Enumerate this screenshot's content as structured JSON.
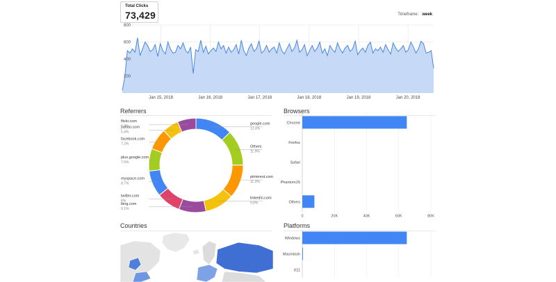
{
  "total_clicks": {
    "label": "Total Clicks",
    "value": "73,429"
  },
  "timeframe": {
    "label": "Timeframe:",
    "value": "week"
  },
  "sections": {
    "referrers": "Referrers",
    "browsers": "Browsers",
    "countries": "Countries",
    "platforms": "Platforms"
  },
  "colors": {
    "accent_blue": "#4285f4",
    "area_fill": "#c6d9f7",
    "line": "#4a86e0"
  },
  "chart_data": [
    {
      "id": "clicks-timeline",
      "type": "area",
      "ylim": [
        0,
        800
      ],
      "y_ticks": [
        "800",
        "600",
        "400",
        "200"
      ],
      "x_tick_labels": [
        "Jan 15, 2018",
        "Jan 16, 2018",
        "Jan 17, 2018",
        "Jan 18, 2018",
        "Jan 19, 2018",
        "Jan 20, 2018"
      ],
      "values": [
        30,
        190,
        500,
        470,
        520,
        480,
        650,
        440,
        520,
        600,
        560,
        490,
        510,
        570,
        430,
        580,
        500,
        460,
        600,
        520,
        470,
        480,
        560,
        520,
        590,
        500,
        470,
        540,
        230,
        510,
        490,
        620,
        480,
        550,
        460,
        500,
        530,
        490,
        600,
        520,
        560,
        470,
        540,
        480,
        510,
        570,
        460,
        620,
        500,
        440,
        530,
        580,
        490,
        520,
        610,
        470,
        500,
        560,
        480,
        520,
        540,
        470,
        590,
        500,
        460,
        520,
        580,
        490,
        530,
        620,
        480,
        510,
        570,
        440,
        500,
        560,
        490,
        530,
        600,
        470,
        520,
        440,
        560,
        510,
        480,
        590,
        520,
        470,
        530,
        560,
        490,
        520,
        610,
        450,
        500,
        530,
        480,
        560,
        600,
        470,
        520,
        500,
        540,
        480,
        570,
        510,
        460,
        590,
        530,
        490,
        520,
        560,
        480,
        510,
        600,
        540,
        470,
        520,
        610,
        580,
        470,
        480,
        500,
        290
      ]
    },
    {
      "id": "referrers-donut",
      "type": "pie",
      "categories": [
        "google.com",
        "Others",
        "pinterest.com",
        "linkedin.com",
        "bing.com",
        "twitter.com",
        "myspace.com",
        "plus.google.com",
        "facebook.com",
        "yahoo.com",
        "flickr.com"
      ],
      "values": [
        12.4,
        11.9,
        11.3,
        9.8,
        9.1,
        8.0,
        8.7,
        7.5,
        7.2,
        5.4,
        6.2
      ],
      "labels_pct": [
        "12.4%",
        "11.9%",
        "11.3%",
        "9.8%",
        "9.1%",
        "8%",
        "8.7%",
        "7.5%",
        "7.2%",
        "5.4%",
        "6.2%"
      ],
      "colors": [
        "#4285f4",
        "#a4cd22",
        "#ff9800",
        "#f4c20d",
        "#9b4b9e",
        "#e0436a",
        "#4285f4",
        "#a4cd22",
        "#ff9800",
        "#f4c20d",
        "#9b4b9e"
      ]
    },
    {
      "id": "browsers-bar",
      "type": "bar",
      "categories": [
        "Chrome",
        "Firefox",
        "Safari",
        "PhantomJS",
        "Others"
      ],
      "values": [
        65000,
        0,
        0,
        0,
        7500
      ],
      "xlim": [
        0,
        80000
      ],
      "x_ticks": [
        "0",
        "20K",
        "40K",
        "60K",
        "80K"
      ]
    },
    {
      "id": "platforms-bar",
      "type": "bar",
      "categories": [
        "Windows",
        "Macintosh",
        "X11"
      ],
      "values": [
        65000,
        400,
        0
      ],
      "xlim": [
        0,
        80000
      ]
    }
  ]
}
